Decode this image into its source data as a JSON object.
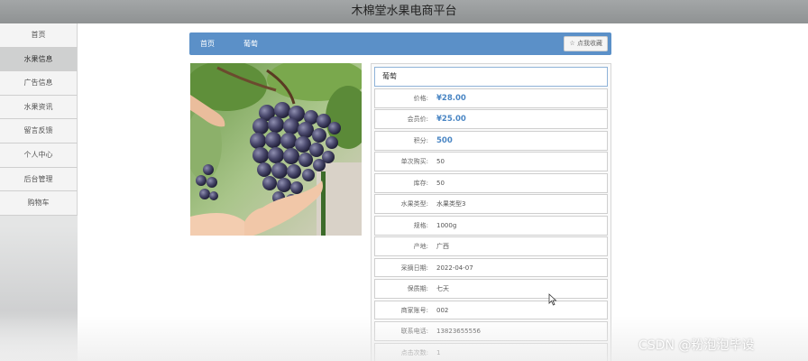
{
  "header": {
    "title": "木棉堂水果电商平台"
  },
  "sidebar": {
    "items": [
      {
        "label": "首页",
        "active": false
      },
      {
        "label": "水果信息",
        "active": true
      },
      {
        "label": "广告信息",
        "active": false
      },
      {
        "label": "水果资讯",
        "active": false
      },
      {
        "label": "留言反馈",
        "active": false
      },
      {
        "label": "个人中心",
        "active": false
      },
      {
        "label": "后台管理",
        "active": false
      },
      {
        "label": "购物车",
        "active": false
      }
    ]
  },
  "breadcrumb": {
    "home": "首页",
    "current": "葡萄",
    "favorite_label": "☆ 点我收藏"
  },
  "product": {
    "name": "葡萄",
    "image_alt": "grapes-photo",
    "fields": [
      {
        "label": "价格:",
        "value": "¥28.00",
        "emphasis": true
      },
      {
        "label": "会员价:",
        "value": "¥25.00",
        "emphasis": true
      },
      {
        "label": "积分:",
        "value": "500",
        "emphasis": true
      },
      {
        "label": "单次购买:",
        "value": "50",
        "emphasis": false
      },
      {
        "label": "库存:",
        "value": "50",
        "emphasis": false
      },
      {
        "label": "水果类型:",
        "value": "水果类型3",
        "emphasis": false
      },
      {
        "label": "规格:",
        "value": "1000g",
        "emphasis": false
      },
      {
        "label": "产地:",
        "value": "广西",
        "emphasis": false
      },
      {
        "label": "采摘日期:",
        "value": "2022-04-07",
        "emphasis": false
      },
      {
        "label": "保质期:",
        "value": "七天",
        "emphasis": false
      },
      {
        "label": "商家账号:",
        "value": "002",
        "emphasis": false
      },
      {
        "label": "联系电话:",
        "value": "13823655556",
        "emphasis": false
      },
      {
        "label": "点击次数:",
        "value": "1",
        "emphasis": false
      }
    ]
  },
  "watermark": "CSDN @粉泡泡毕设",
  "colors": {
    "accent": "#5b90c8",
    "price": "#4a86c4",
    "header": "#9a9d9e"
  }
}
